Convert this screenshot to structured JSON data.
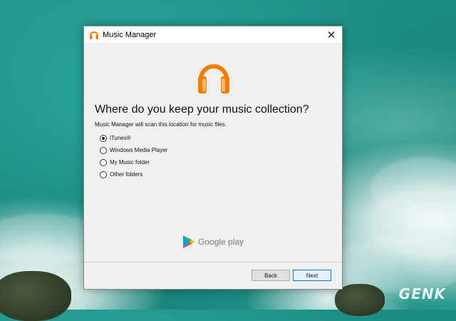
{
  "window": {
    "title": "Music Manager",
    "close_glyph": "✕",
    "icon": "headphones-icon"
  },
  "main": {
    "heading": "Where do you keep your music collection?",
    "subtitle": "Music Manager will scan this location for music files.",
    "options": [
      {
        "label": "iTunes®",
        "checked": true
      },
      {
        "label": "Windows Media Player",
        "checked": false
      },
      {
        "label": "My Music folder",
        "checked": false
      },
      {
        "label": "Other folders",
        "checked": false
      }
    ],
    "brand_text": "Google play"
  },
  "footer": {
    "back_label": "Back",
    "next_label": "Next"
  },
  "watermark": "GENK",
  "colors": {
    "headphones_orange": "#f57c00",
    "play_blue": "#00a0e9",
    "play_green": "#3bb54a",
    "play_red": "#e64a3b",
    "play_yellow": "#f6b900"
  }
}
